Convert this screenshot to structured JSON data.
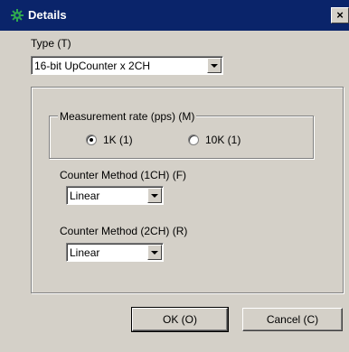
{
  "window": {
    "title": "Details",
    "close_label": "×",
    "icon": "gear-icon",
    "title_color": "#0a246a"
  },
  "type": {
    "label": "Type (T)",
    "value": "16-bit UpCounter x 2CH"
  },
  "measurement": {
    "legend": "Measurement rate (pps) (M)",
    "options": [
      {
        "label": "1K (1)",
        "checked": true
      },
      {
        "label": "10K (1)",
        "checked": false
      }
    ]
  },
  "counter1": {
    "label": "Counter Method (1CH) (F)",
    "value": "Linear"
  },
  "counter2": {
    "label": "Counter Method (2CH) (R)",
    "value": "Linear"
  },
  "buttons": {
    "ok": "OK (O)",
    "cancel": "Cancel (C)"
  }
}
